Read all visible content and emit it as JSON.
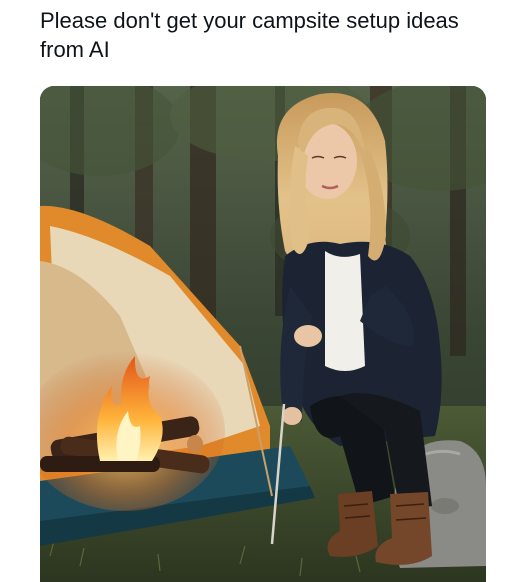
{
  "post": {
    "caption": "Please don't get your campsite setup ideas from AI"
  },
  "media": {
    "alt": "",
    "colors": {
      "forest_dark": "#1f2a1c",
      "forest_mid": "#3d4a33",
      "tent_orange": "#e08a2c",
      "tent_canvas": "#e9d8b8",
      "fire_core": "#ffd46a",
      "fire_outer": "#f07a1a",
      "jacket": "#1c2433",
      "hair": "#d9b37a",
      "boots": "#6b3f24",
      "rock": "#8a8a86"
    }
  }
}
